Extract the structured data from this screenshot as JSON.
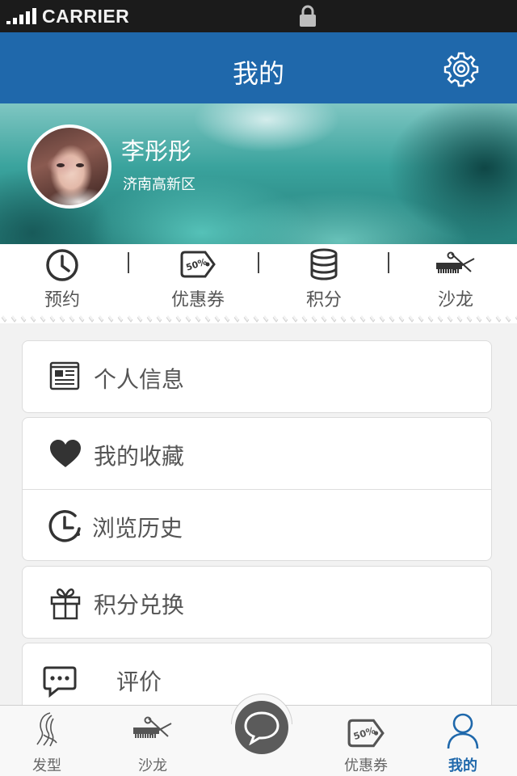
{
  "status_bar": {
    "carrier": "CARRIER"
  },
  "nav": {
    "title": "我的",
    "settings_icon": "gear-icon"
  },
  "profile": {
    "name": "李彤彤",
    "location": "济南高新区"
  },
  "quick_actions": [
    {
      "label": "预约",
      "icon": "clock-icon"
    },
    {
      "label": "优惠券",
      "icon": "coupon-tag-icon"
    },
    {
      "label": "积分",
      "icon": "coins-stack-icon"
    },
    {
      "label": "沙龙",
      "icon": "comb-scissors-icon"
    }
  ],
  "menu": {
    "personal_info": "个人信息",
    "favorites": "我的收藏",
    "history": "浏览历史",
    "points_exchange": "积分兑换",
    "reviews": "评价"
  },
  "tabbar": {
    "tabs": [
      {
        "label": "发型",
        "icon": "hairstyle-icon"
      },
      {
        "label": "沙龙",
        "icon": "comb-scissors-icon"
      },
      {
        "label": "",
        "icon": "chat-bubble-icon"
      },
      {
        "label": "优惠券",
        "icon": "coupon-tag-icon"
      },
      {
        "label": "我的",
        "icon": "person-icon"
      }
    ],
    "active_color": "#1f68ab"
  },
  "colors": {
    "nav_bg": "#1f68ab",
    "page_bg": "#f2f2f2"
  }
}
